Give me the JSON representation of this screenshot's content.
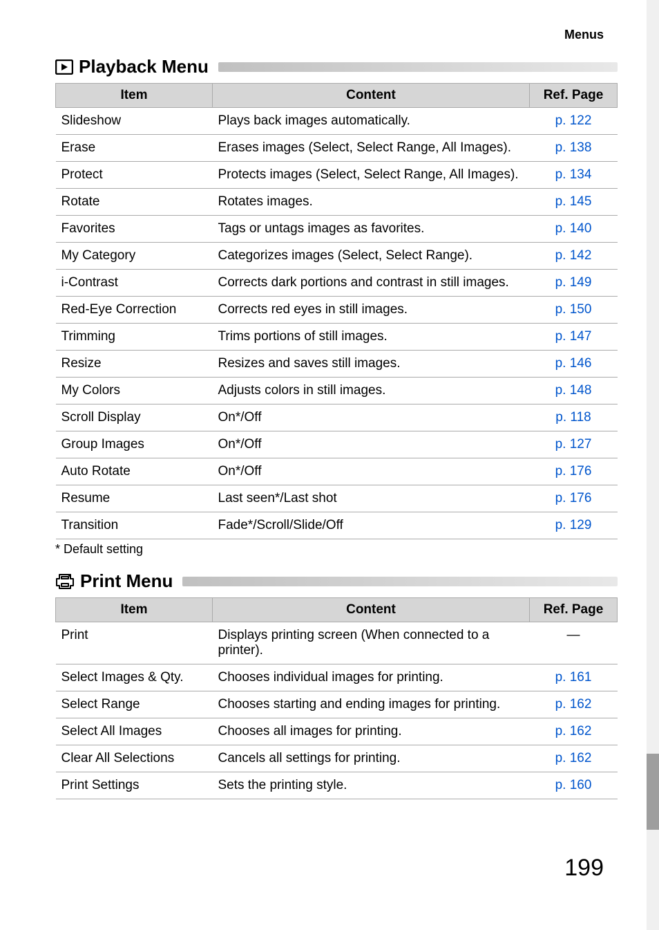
{
  "header": {
    "label": "Menus"
  },
  "playback": {
    "title": "Playback Menu",
    "columns": {
      "item": "Item",
      "content": "Content",
      "ref": "Ref. Page"
    },
    "rows": [
      {
        "item": "Slideshow",
        "content": "Plays back images automatically.",
        "ref": "p. 122"
      },
      {
        "item": "Erase",
        "content": "Erases images (Select, Select Range, All Images).",
        "ref": "p. 138"
      },
      {
        "item": "Protect",
        "content": "Protects images (Select, Select Range, All Images).",
        "ref": "p. 134"
      },
      {
        "item": "Rotate",
        "content": "Rotates images.",
        "ref": "p. 145"
      },
      {
        "item": "Favorites",
        "content": "Tags or untags images as favorites.",
        "ref": "p. 140"
      },
      {
        "item": "My Category",
        "content": "Categorizes images (Select, Select Range).",
        "ref": "p. 142"
      },
      {
        "item": "i-Contrast",
        "content": "Corrects dark portions and contrast in still images.",
        "ref": "p. 149"
      },
      {
        "item": "Red-Eye Correction",
        "content": "Corrects red eyes in still images.",
        "ref": "p. 150"
      },
      {
        "item": "Trimming",
        "content": "Trims portions of still images.",
        "ref": "p. 147"
      },
      {
        "item": "Resize",
        "content": "Resizes and saves still images.",
        "ref": "p. 146"
      },
      {
        "item": "My Colors",
        "content": "Adjusts colors in still images.",
        "ref": "p. 148"
      },
      {
        "item": "Scroll Display",
        "content": "On*/Off",
        "ref": "p. 118"
      },
      {
        "item": "Group Images",
        "content": "On*/Off",
        "ref": "p. 127"
      },
      {
        "item": "Auto Rotate",
        "content": "On*/Off",
        "ref": "p. 176"
      },
      {
        "item": "Resume",
        "content": "Last seen*/Last shot",
        "ref": "p. 176"
      },
      {
        "item": "Transition",
        "content": "Fade*/Scroll/Slide/Off",
        "ref": "p. 129"
      }
    ],
    "footnote": "* Default setting"
  },
  "print": {
    "title": "Print Menu",
    "columns": {
      "item": "Item",
      "content": "Content",
      "ref": "Ref. Page"
    },
    "rows": [
      {
        "item": "Print",
        "content": "Displays printing screen (When connected to a printer).",
        "ref": "—"
      },
      {
        "item": "Select Images & Qty.",
        "content": "Chooses individual images for printing.",
        "ref": "p. 161"
      },
      {
        "item": "Select Range",
        "content": "Chooses starting and ending images for printing.",
        "ref": "p. 162"
      },
      {
        "item": "Select All Images",
        "content": "Chooses all images for printing.",
        "ref": "p. 162"
      },
      {
        "item": "Clear All Selections",
        "content": "Cancels all settings for printing.",
        "ref": "p. 162"
      },
      {
        "item": "Print Settings",
        "content": "Sets the printing style.",
        "ref": "p. 160"
      }
    ]
  },
  "pageNumber": "199"
}
